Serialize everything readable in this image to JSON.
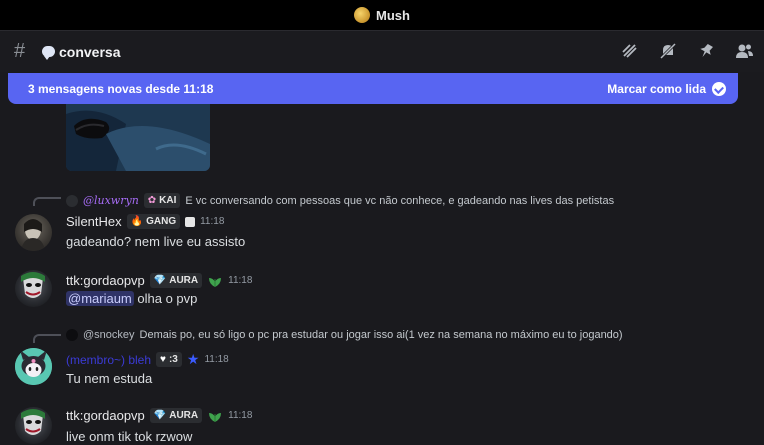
{
  "window": {
    "server_name": "Mush"
  },
  "channel": {
    "name": "conversa"
  },
  "banner": {
    "text": "3 mensagens novas desde 11:18",
    "action": "Marcar como lida"
  },
  "messages": [
    {
      "reply": {
        "name": "@luxwryn",
        "tag": "KAI",
        "text": "E vc conversando com pessoas que vc não conhece, e gadeando nas lives das petistas"
      },
      "username": "SilentHex",
      "tag": "GANG",
      "time": "11:18",
      "content": "gadeando? nem live eu assisto"
    },
    {
      "username": "ttk:gordaopvp",
      "tag": "AURA",
      "time": "11:18",
      "mention": "@mariaum",
      "content": "olha o pvp"
    },
    {
      "reply": {
        "name": "@snockey",
        "text": "Demais po, eu só ligo o pc pra estudar ou jogar isso ai(1 vez na semana no máximo eu to jogando)"
      },
      "username": "(membro~) bleh",
      "tag": ":3",
      "time": "11:18",
      "content": "Tu nem estuda"
    },
    {
      "username": "ttk:gordaopvp",
      "tag": "AURA",
      "time": "11:18",
      "content": "live onm tik tok rzwow"
    }
  ]
}
